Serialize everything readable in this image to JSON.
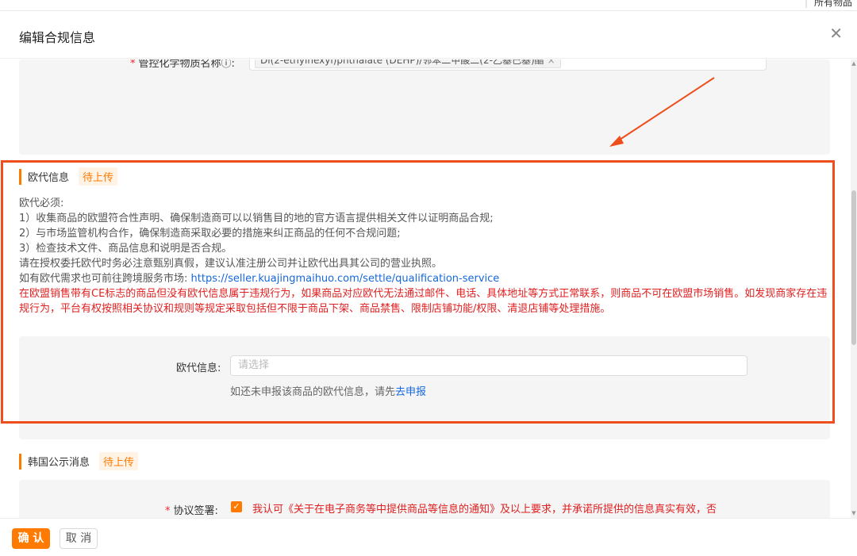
{
  "top_corner": {
    "label": "所有物品"
  },
  "dialog": {
    "title": "编辑合规信息"
  },
  "chemical": {
    "label": "管控化学物质名称ⓘ:",
    "tag": "Di(2-ethylhexyl)phthalate (DEHP)/邻苯二甲酸二(2-乙基己基)酯",
    "tag_close": "×"
  },
  "eu_rep": {
    "title": "欧代信息",
    "badge": "待上传",
    "lines": [
      "欧代必须:",
      "1）收集商品的欧盟符合性声明、确保制造商可以以销售目的地的官方语言提供相关文件以证明商品合规;",
      "2）与市场监管机构合作，确保制造商采取必要的措施来纠正商品的任何不合规问题;",
      "3）检查技术文件、商品信息和说明是否合规。",
      "请在授权委托欧代时务必注意甄别真假，建议认准注册公司并让欧代出具其公司的营业执照。"
    ],
    "service_prefix": "如有欧代需求也可前往跨境服务市场:",
    "service_link": "https://seller.kuajingmaihuo.com/settle/qualification-service",
    "warning": "在欧盟销售带有CE标志的商品但没有欧代信息属于违规行为，如果商品对应欧代无法通过邮件、电话、具体地址等方式正常联系，则商品不可在欧盟市场销售。如发现商家存在违规行为，平台有权按照相关协议和规则等规定采取包括但不限于商品下架、商品禁售、限制店铺功能/权限、清退店铺等处理措施。",
    "field_label": "欧代信息:",
    "field_placeholder": "请选择",
    "hint_prefix": "如还未申报该商品的欧代信息，请先",
    "hint_link": "去申报"
  },
  "korea": {
    "title": "韩国公示消息",
    "badge": "待上传",
    "sign_label": "协议签署:",
    "checkbox_mark": "✓",
    "sign_text": "我认可《关于在电子商务等中提供商品等信息的通知》及以上要求，并承诺所提供的信息真实有效，否"
  },
  "footer": {
    "ok_label": "确 认",
    "cancel_label": "取 消"
  },
  "colors": {
    "accent": "#ff7a00",
    "warning": "#e02020",
    "link": "#1668dc",
    "annotation": "#ee4d1c"
  },
  "icons": {
    "close": "close-icon",
    "info": "info-circle-icon",
    "check": "checkbox-checked-icon"
  }
}
